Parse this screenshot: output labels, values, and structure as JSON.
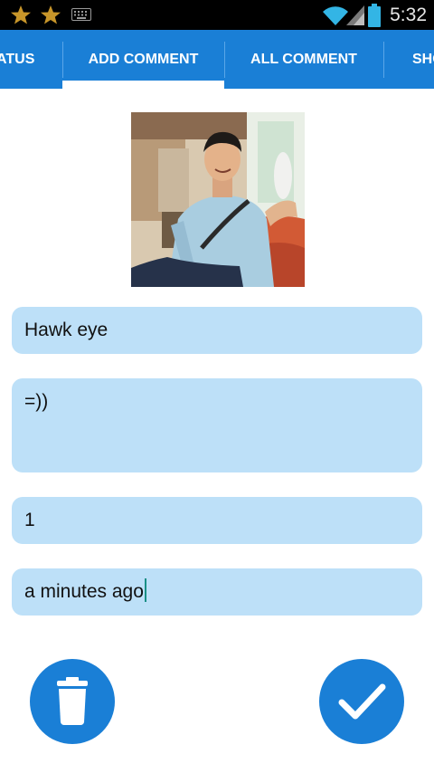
{
  "status_bar": {
    "time": "5:32",
    "icons": [
      "star-icon",
      "star-icon",
      "keyboard-icon",
      "wifi-icon",
      "signal-icon",
      "battery-icon"
    ]
  },
  "tabs": [
    {
      "label": "ATUS",
      "selected": false
    },
    {
      "label": "ADD COMMENT",
      "selected": true
    },
    {
      "label": "ALL COMMENT",
      "selected": false
    },
    {
      "label": "SHO",
      "selected": false
    }
  ],
  "form": {
    "name_value": "Hawk eye",
    "comment_value": "=))",
    "count_value": "1",
    "time_value": "a minutes ago"
  },
  "actions": {
    "delete_icon": "trash-icon",
    "confirm_icon": "checkmark-icon"
  },
  "colors": {
    "accent": "#1a7fd6",
    "field_background": "#bde0f8",
    "status_bar": "#000000"
  }
}
